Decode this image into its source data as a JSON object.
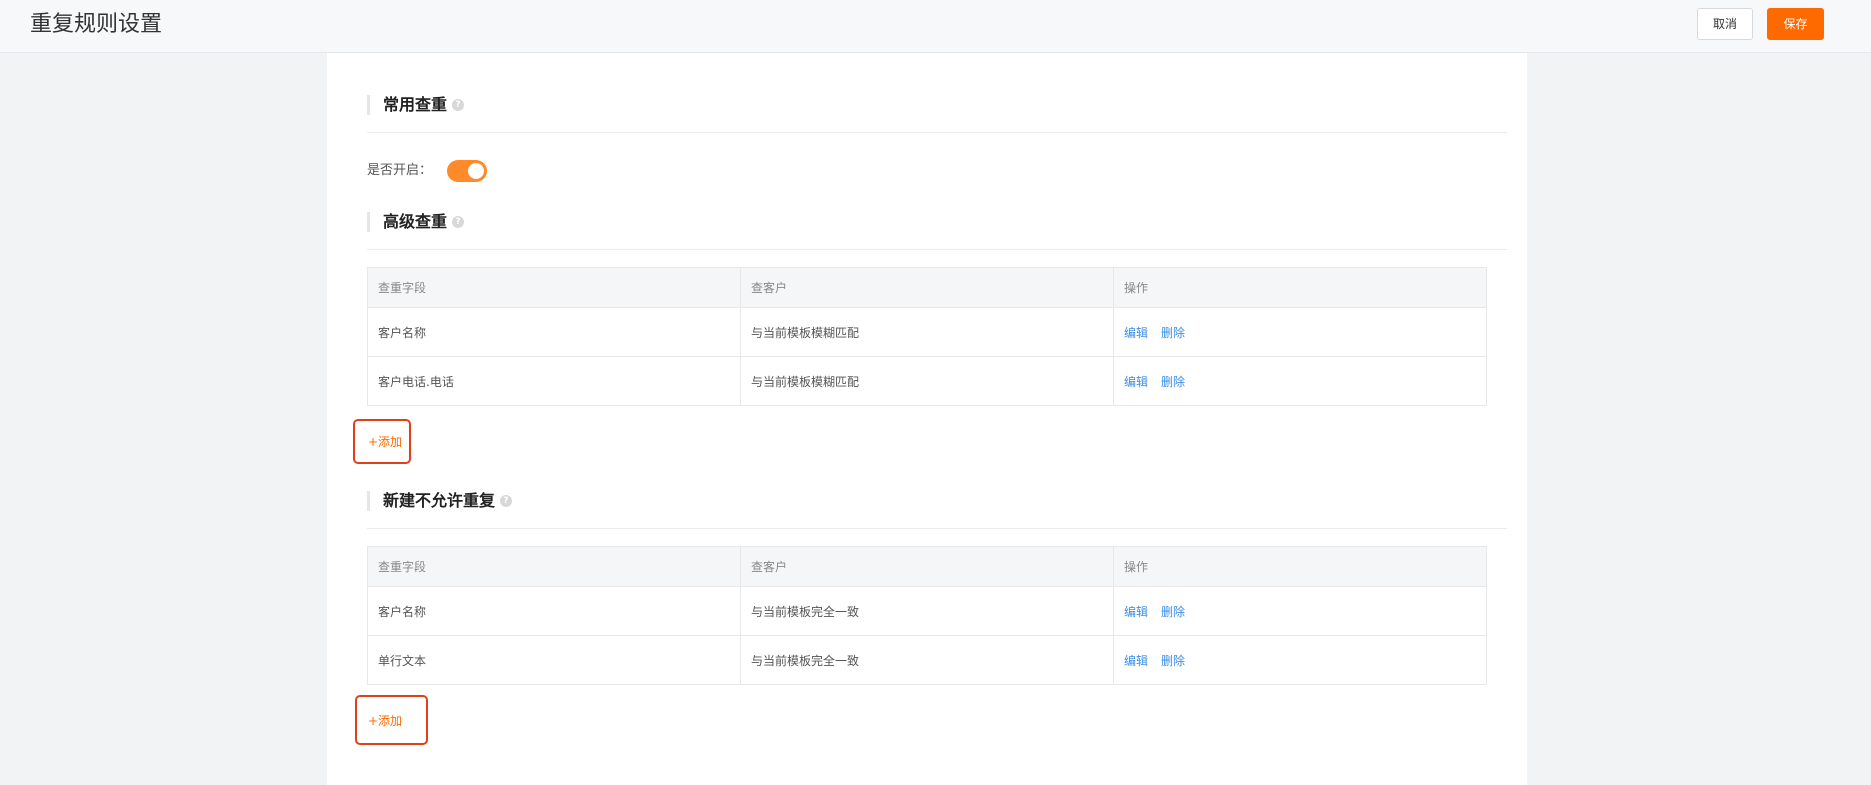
{
  "header": {
    "title": "重复规则设置",
    "cancel_label": "取消",
    "save_label": "保存"
  },
  "common_check": {
    "title": "常用查重",
    "help_icon": "?",
    "toggle_label": "是否开启：",
    "enabled": true
  },
  "advanced_check": {
    "title": "高级查重",
    "help_icon": "?",
    "columns": [
      "查重字段",
      "查客户",
      "操作"
    ],
    "rows": [
      {
        "field": "客户名称",
        "rule": "与当前模板模糊匹配",
        "edit": "编辑",
        "delete": "删除"
      },
      {
        "field": "客户电话.电话",
        "rule": "与当前模板模糊匹配",
        "edit": "编辑",
        "delete": "删除"
      }
    ],
    "add_label": "+添加"
  },
  "no_duplicate": {
    "title": "新建不允许重复",
    "help_icon": "?",
    "columns": [
      "查重字段",
      "查客户",
      "操作"
    ],
    "rows": [
      {
        "field": "客户名称",
        "rule": "与当前模板完全一致",
        "edit": "编辑",
        "delete": "删除"
      },
      {
        "field": "单行文本",
        "rule": "与当前模板完全一致",
        "edit": "编辑",
        "delete": "删除"
      }
    ],
    "add_label": "+添加"
  },
  "colors": {
    "accent": "#ff6a00",
    "toggle_on": "#ff8a2a",
    "link": "#3a8ee6",
    "highlight": "#e0401c"
  }
}
